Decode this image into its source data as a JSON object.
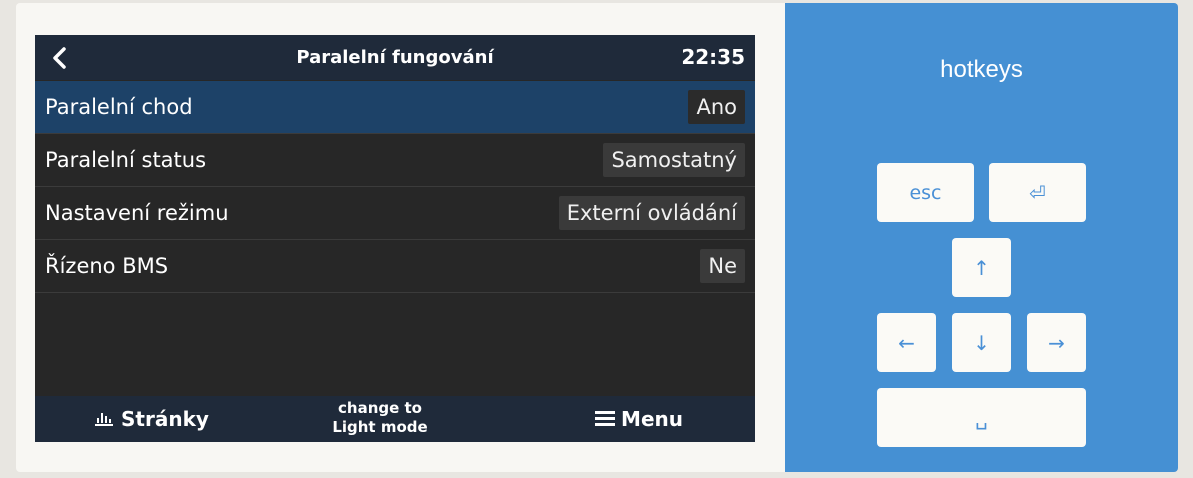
{
  "header": {
    "back_icon": "chevron-left-icon",
    "title": "Paralelní fungování",
    "time": "22:35"
  },
  "settings": [
    {
      "label": "Paralelní chod",
      "value": "Ano",
      "selected": true
    },
    {
      "label": "Paralelní status",
      "value": "Samostatný",
      "selected": false
    },
    {
      "label": "Nastavení režimu",
      "value": "Externí ovládání",
      "selected": false
    },
    {
      "label": "Řízeno BMS",
      "value": "Ne",
      "selected": false
    }
  ],
  "footer": {
    "pages_icon": "bar-chart-icon",
    "pages_label": "Stránky",
    "mode_line1": "change to",
    "mode_line2": "Light mode",
    "menu_icon": "hamburger-icon",
    "menu_label": "Menu"
  },
  "hotkeys": {
    "title": "hotkeys",
    "esc": "esc",
    "enter": "⏎",
    "up": "↑",
    "left": "←",
    "down": "↓",
    "right": "→",
    "space": "␣"
  },
  "colors": {
    "titlebar": "#1f2a3a",
    "selected_row": "#1d4268",
    "hotkey_panel": "#4590d3"
  }
}
